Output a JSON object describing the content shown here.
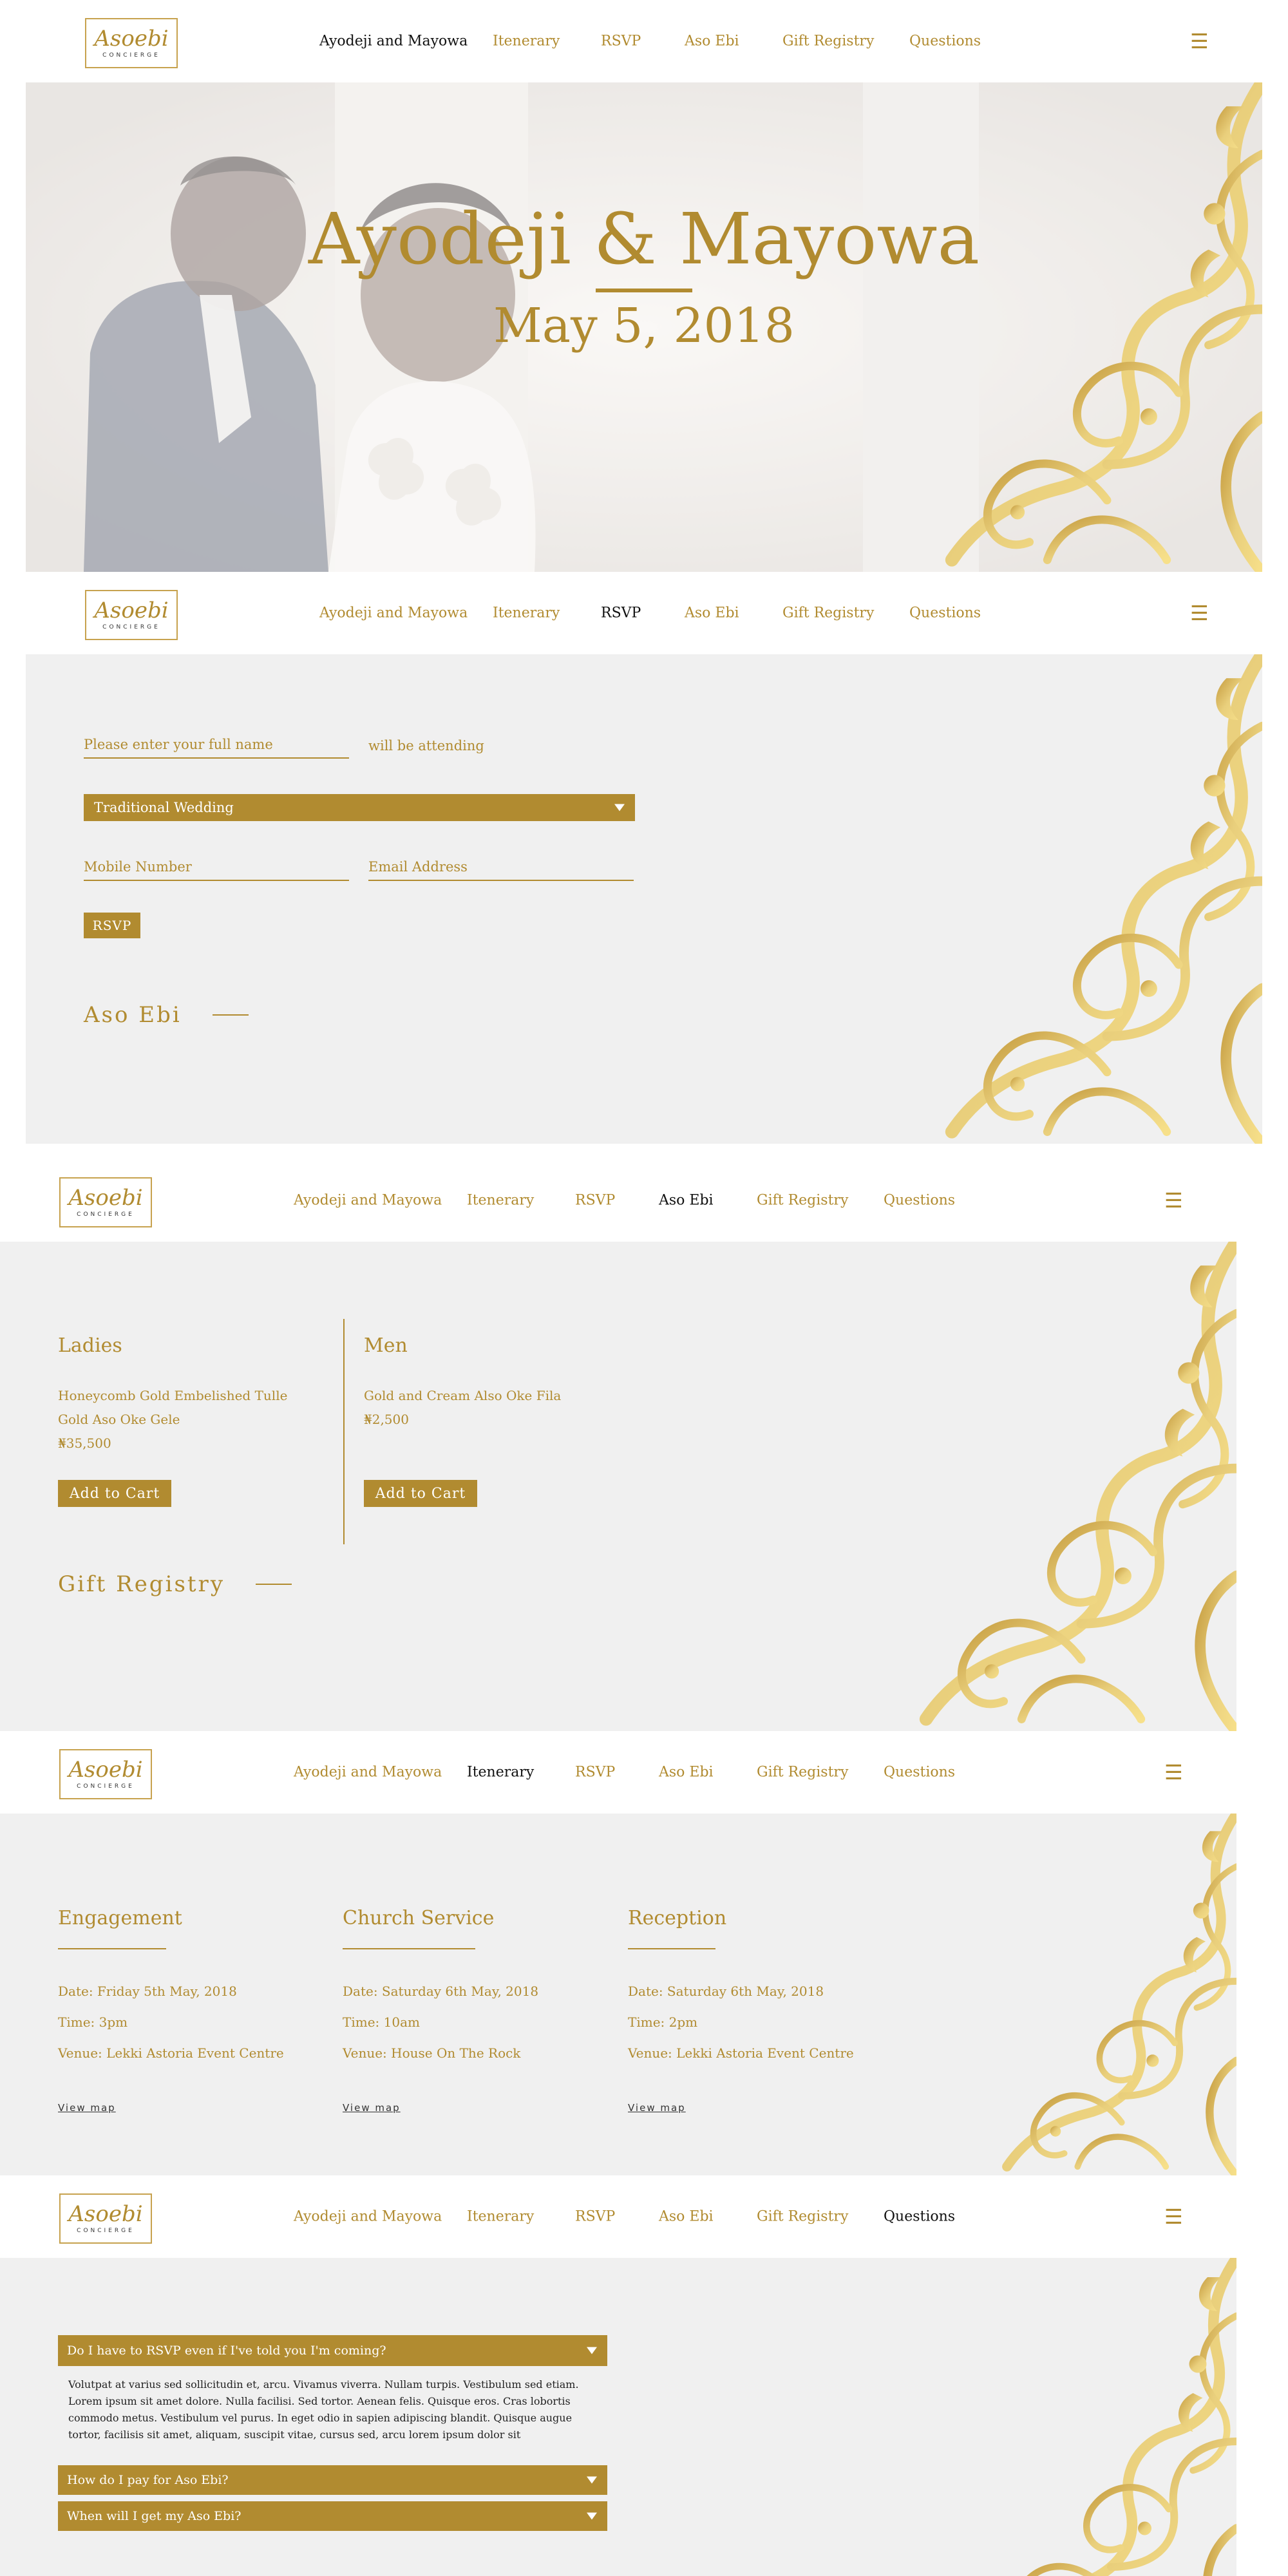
{
  "logo": {
    "script": "Asoebi",
    "sub": "CONCIERGE"
  },
  "nav": {
    "items": [
      "Ayodeji and Mayowa",
      "Itenerary",
      "RSVP",
      "Aso Ebi",
      "Gift Registry",
      "Questions"
    ],
    "menu_icon": "hamburger-icon"
  },
  "hero": {
    "title": "Ayodeji & Mayowa",
    "date": "May 5, 2018"
  },
  "rsvp": {
    "name_placeholder": "Please enter your full name",
    "attending_text": "will be attending",
    "event_select": "Traditional Wedding",
    "mobile_placeholder": "Mobile Number",
    "email_placeholder": "Email Address",
    "button": "RSVP",
    "next_section": "Aso Ebi"
  },
  "asoebi": {
    "ladies": {
      "title": "Ladies",
      "item_line1": "Honeycomb Gold Embelished Tulle",
      "item_line2": "Gold Aso Oke Gele",
      "price": "₦35,500",
      "button": "Add to Cart"
    },
    "men": {
      "title": "Men",
      "item": "Gold and Cream Also Oke Fila",
      "price": "₦2,500",
      "button": "Add to Cart"
    },
    "next_section": "Gift Registry"
  },
  "itinerary": {
    "events": [
      {
        "title": "Engagement",
        "date": "Date: Friday 5th May, 2018",
        "time": "Time: 3pm",
        "venue": "Venue: Lekki Astoria Event Centre",
        "link": "View map"
      },
      {
        "title": "Church Service",
        "date": "Date: Saturday 6th May, 2018",
        "time": "Time: 10am",
        "venue": "Venue: House On The Rock",
        "link": "View map"
      },
      {
        "title": "Reception",
        "date": "Date: Saturday 6th May, 2018",
        "time": "Time: 2pm",
        "venue": "Venue: Lekki Astoria Event Centre",
        "link": "View map"
      }
    ]
  },
  "faq": {
    "questions": [
      "Do I have to RSVP even if I've told you I'm coming?",
      "How do I pay for Aso Ebi?",
      "When will I get my Aso Ebi?"
    ],
    "answer": "Volutpat at varius sed sollicitudin et, arcu. Vivamus viverra. Nullam turpis. Vestibulum sed etiam. Lorem ipsum sit amet dolore. Nulla facilisi. Sed tortor. Aenean felis. Quisque eros. Cras lobortis commodo metus. Vestibulum vel purus. In eget odio in sapien adipiscing blandit. Quisque augue tortor, facilisis sit amet, aliquam, suscipit vitae, cursus sed, arcu lorem ipsum dolor sit"
  },
  "colors": {
    "gold": "#b18b30",
    "panel": "#f0f0f0",
    "active_nav": "#111111"
  }
}
